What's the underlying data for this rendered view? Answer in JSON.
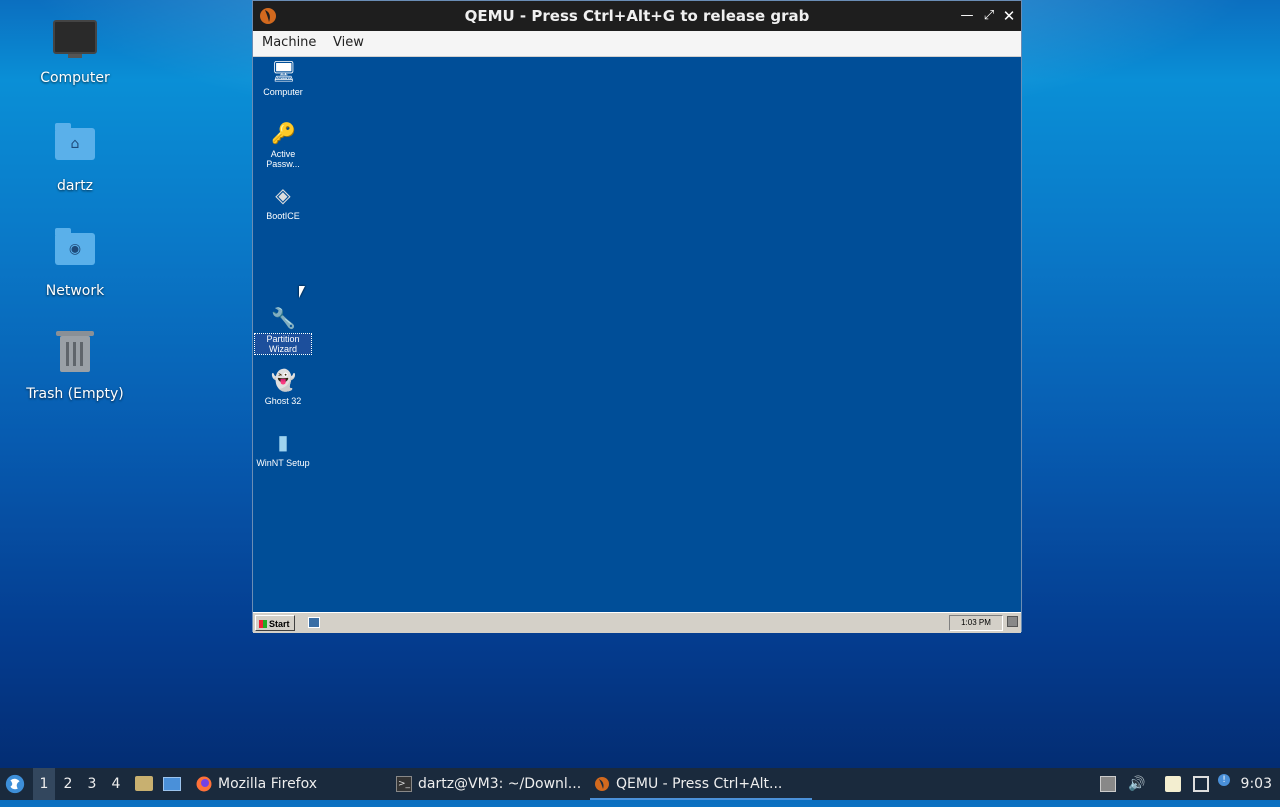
{
  "desktop": {
    "icons": [
      {
        "label": "Computer",
        "icon": "monitor-icon"
      },
      {
        "label": "dartz",
        "icon": "home-folder-icon"
      },
      {
        "label": "Network",
        "icon": "network-folder-icon"
      },
      {
        "label": "Trash (Empty)",
        "icon": "trash-icon"
      }
    ]
  },
  "qemu": {
    "title": "QEMU - Press Ctrl+Alt+G to release grab",
    "menu": [
      "Machine",
      "View"
    ],
    "guest": {
      "icons": [
        {
          "label": "Computer",
          "icon": "computer-icon"
        },
        {
          "label": "Active Passw...",
          "icon": "key-icon"
        },
        {
          "label": "BootICE",
          "icon": "bootice-icon"
        },
        {
          "label": "Partition Wizard",
          "icon": "partition-wizard-icon"
        },
        {
          "label": "Ghost 32",
          "icon": "ghost-icon"
        },
        {
          "label": "WinNT Setup",
          "icon": "setup-icon"
        }
      ],
      "taskbar": {
        "start_label": "Start",
        "clock": "1:03 PM"
      }
    }
  },
  "taskbar": {
    "workspaces": [
      "1",
      "2",
      "3",
      "4"
    ],
    "active_workspace": "1",
    "tasks": [
      {
        "label": "Mozilla Firefox",
        "icon": "firefox-icon"
      },
      {
        "label": "dartz@VM3: ~/Downl...",
        "icon": "terminal-icon"
      },
      {
        "label": "QEMU - Press Ctrl+Alt...",
        "icon": "qemu-icon",
        "active": true
      }
    ],
    "clock": "9:03"
  },
  "colors": {
    "guest_desktop": "#004e98",
    "host_taskbar": "#1a2a3d",
    "accent": "#4a90d9"
  }
}
